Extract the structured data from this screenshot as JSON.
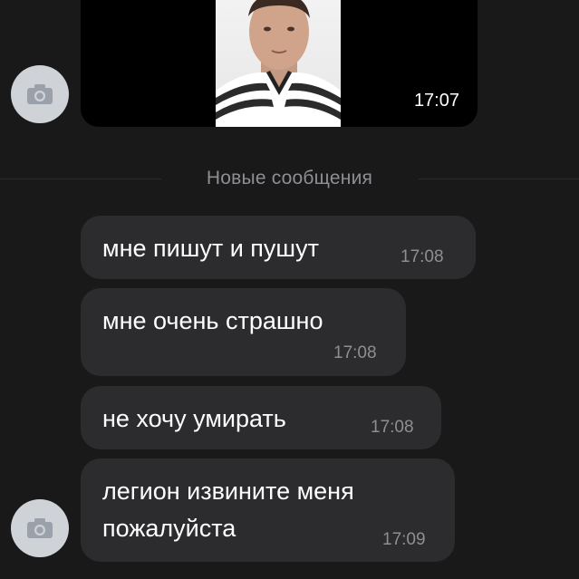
{
  "chat": {
    "photo_message": {
      "time": "17:07"
    },
    "divider_label": "Новые сообщения",
    "messages": [
      {
        "text_lines": [
          "мне пишут и пушут"
        ],
        "time": "17:08"
      },
      {
        "text_lines": [
          "мне очень страшно"
        ],
        "time": "17:08"
      },
      {
        "text_lines": [
          "не хочу умирать"
        ],
        "time": "17:08"
      },
      {
        "text_lines": [
          "легион извините меня",
          "пожалуйста"
        ],
        "time": "17:09"
      }
    ]
  },
  "icons": {
    "avatar_top": "camera-icon",
    "avatar_bottom": "camera-icon"
  },
  "colors": {
    "background": "#19191a",
    "bubble": "#2c2c2e",
    "timestamp": "#8e8e93",
    "avatar": "#cfd3d8"
  }
}
